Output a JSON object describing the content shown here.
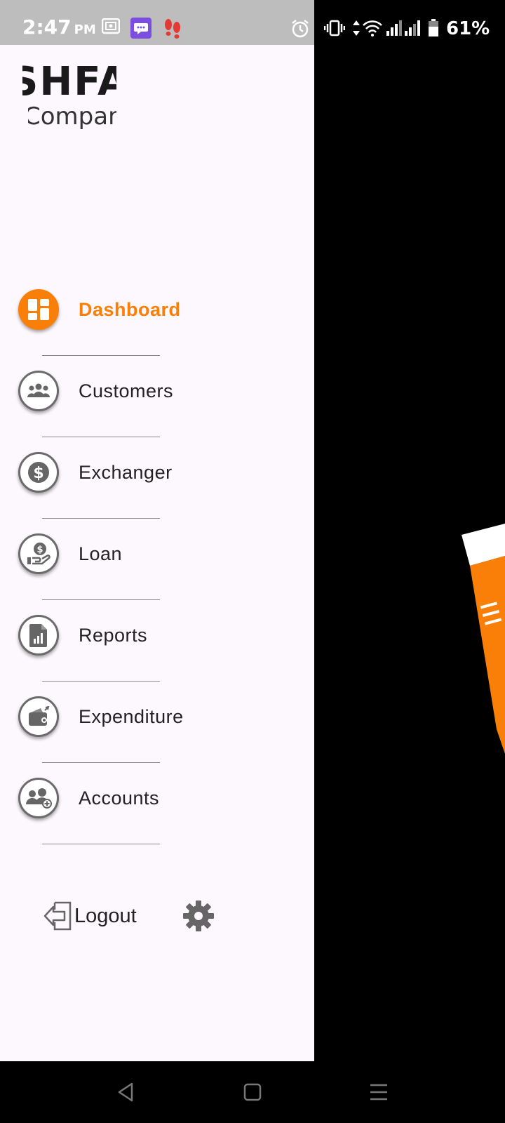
{
  "status_bar": {
    "time": "2:47",
    "ampm": "PM",
    "battery_percent": "61%",
    "icons": [
      "screenshot-icon",
      "message-app-icon",
      "footsteps-icon",
      "alarm-icon",
      "vibrate-icon",
      "data-arrows-icon",
      "wifi-icon",
      "signal-icon",
      "signal-icon",
      "battery-icon"
    ]
  },
  "logo": {
    "line1": "SHFA",
    "line2": "Company"
  },
  "menu": {
    "items": [
      {
        "label": "Dashboard",
        "icon": "dashboard-icon",
        "active": true
      },
      {
        "label": "Customers",
        "icon": "customers-icon",
        "active": false
      },
      {
        "label": "Exchanger",
        "icon": "dollar-icon",
        "active": false
      },
      {
        "label": "Loan",
        "icon": "loan-hand-icon",
        "active": false
      },
      {
        "label": "Reports",
        "icon": "report-doc-icon",
        "active": false
      },
      {
        "label": "Expenditure",
        "icon": "wallet-icon",
        "active": false
      },
      {
        "label": "Accounts",
        "icon": "add-user-icon",
        "active": false
      }
    ]
  },
  "footer": {
    "logout_label": "Logout",
    "logout_icon": "logout-icon",
    "settings_icon": "gear-icon"
  },
  "colors": {
    "accent": "#fa7f08",
    "drawer_bg": "#fdf8fd",
    "icon_gray": "#6b6b6b",
    "status_bar_bg": "#bdbdbd"
  },
  "nav_bar": {
    "buttons": [
      "back-icon",
      "home-icon",
      "menu-icon"
    ]
  }
}
